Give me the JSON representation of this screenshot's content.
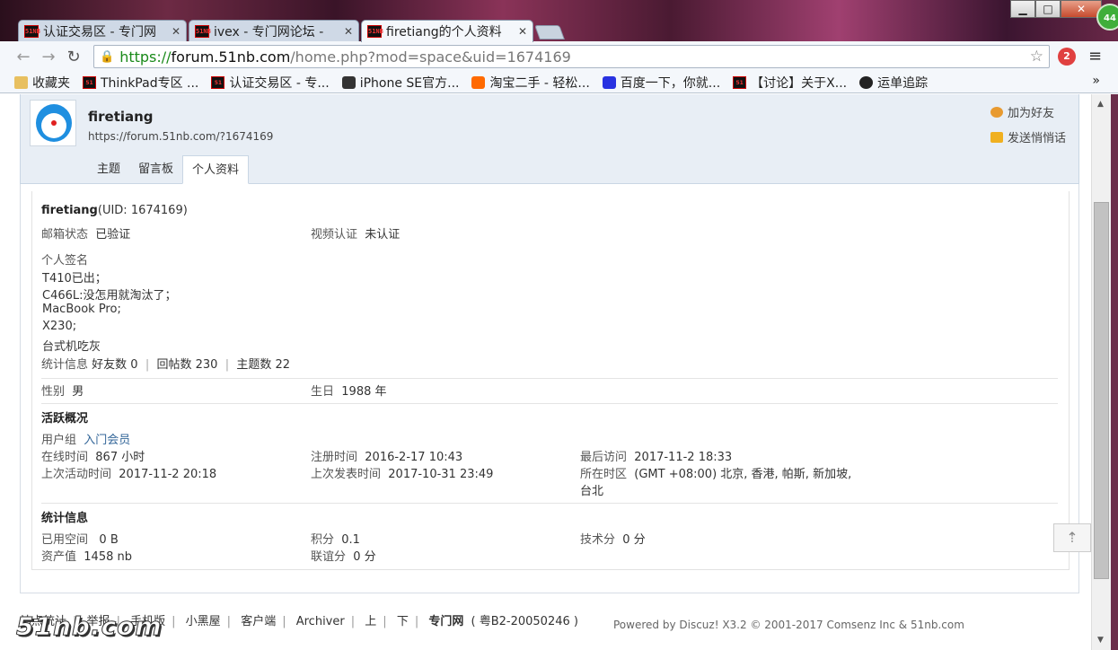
{
  "browser": {
    "tabs": [
      {
        "title": "认证交易区 - 专门网",
        "favicon": "51nb-favicon"
      },
      {
        "title": "ivex - 专门网论坛 - ",
        "favicon": "51nb-favicon"
      },
      {
        "title": "firetiang的个人资料",
        "favicon": "51nb-favicon"
      }
    ],
    "url_scheme": "https://",
    "url_host": "forum.51nb.com",
    "url_rest": "/home.php?mod=space&uid=1674169",
    "extension_badge": "2",
    "corner_badge": "44",
    "bookmarks_folder": "收藏夹",
    "bookmarks": [
      {
        "label": "ThinkPad专区 ...",
        "icon": "51nb-favicon"
      },
      {
        "label": "认证交易区 - 专...",
        "icon": "51nb-favicon"
      },
      {
        "label": "iPhone SE官方...",
        "icon": "apple-icon"
      },
      {
        "label": "淘宝二手 - 轻松...",
        "icon": "taobao-icon"
      },
      {
        "label": "百度一下，你就...",
        "icon": "baidu-icon"
      },
      {
        "label": "【讨论】关于X...",
        "icon": "51nb-favicon"
      },
      {
        "label": "运单追踪",
        "icon": "sf-icon"
      }
    ],
    "bookmarks_more": "»"
  },
  "profile": {
    "username": "firetiang",
    "space_url": "https://forum.51nb.com/?1674169",
    "add_friend": "加为好友",
    "send_message": "发送悄悄话",
    "tabs": [
      "主题",
      "留言板",
      "个人资料"
    ],
    "active_tab": "个人资料",
    "name_line": "firetiang",
    "uid_text": "(UID: 1674169)",
    "email_status_label": "邮箱状态",
    "email_status_value": "已验证",
    "video_auth_label": "视频认证",
    "video_auth_value": "未认证",
    "signature_label": "个人签名",
    "signature_lines": [
      "T410已出；",
      "C466L:没怎用就淘汰了；",
      "MacBook Pro;",
      "X230;",
      "台式机吃灰"
    ],
    "stats_label": "统计信息",
    "stats_friends": "好友数 0",
    "stats_replies": "回帖数 230",
    "stats_threads": "主题数 22",
    "gender_label": "性别",
    "gender_value": "男",
    "birthday_label": "生日",
    "birthday_value": "1988 年"
  },
  "activity": {
    "title": "活跃概况",
    "usergroup_label": "用户组",
    "usergroup_value": "入门会员",
    "online_label": "在线时间",
    "online_value": "867 小时",
    "register_label": "注册时间",
    "register_value": "2016-2-17 10:43",
    "last_visit_label": "最后访问",
    "last_visit_value": "2017-11-2 18:33",
    "last_active_label": "上次活动时间",
    "last_active_value": "2017-11-2 20:18",
    "last_post_label": "上次发表时间",
    "last_post_value": "2017-10-31 23:49",
    "timezone_label": "所在时区",
    "timezone_value_1": "(GMT +08:00) 北京, 香港, 帕斯, 新加坡,",
    "timezone_value_2": "台北"
  },
  "statistics": {
    "title": "统计信息",
    "space_label": "已用空间",
    "space_value": "0 B",
    "points_label": "积分",
    "points_value": "0.1",
    "tech_label": "技术分",
    "tech_value": "0 分",
    "assets_label": "资产值",
    "assets_value": "1458 nb",
    "alliance_label": "联谊分",
    "alliance_value": "0 分"
  },
  "footer": {
    "links": [
      "站点统计",
      "举报",
      "手机版",
      "小黑屋",
      "客户端",
      "Archiver",
      "上",
      "下"
    ],
    "site_name": "专门网",
    "icp": "( 粤B2-20050246 )",
    "powered": "Powered by Discuz! X3.2 © 2001-2017 Comsenz Inc & 51nb.com",
    "logo_text": "51nb.com"
  }
}
